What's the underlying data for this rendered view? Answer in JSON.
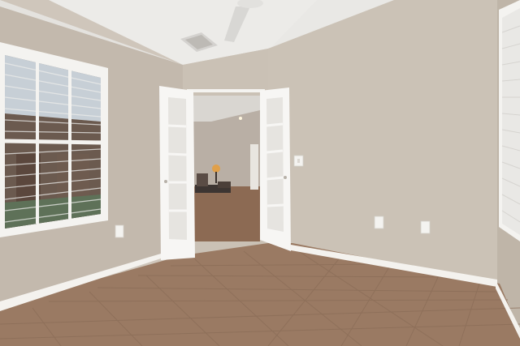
{
  "scene": {
    "description_free": true,
    "room": {
      "wall_color": "#c9bfb3",
      "ceiling_color": "#ecebe8",
      "floor_tile_color": "#9a7a63",
      "baseboard_color": "#f4f2ee"
    },
    "doors": {
      "type": "french-doors",
      "frame_color": "#f7f6f4",
      "glass_color": "#e8e6e2"
    },
    "windows": {
      "blind_color": "#ededeb"
    },
    "icons": {
      "ceiling_fan": "ceiling-fan-icon",
      "vent": "air-vent-icon",
      "outlet": "power-outlet-icon",
      "switch": "light-switch-icon"
    }
  }
}
